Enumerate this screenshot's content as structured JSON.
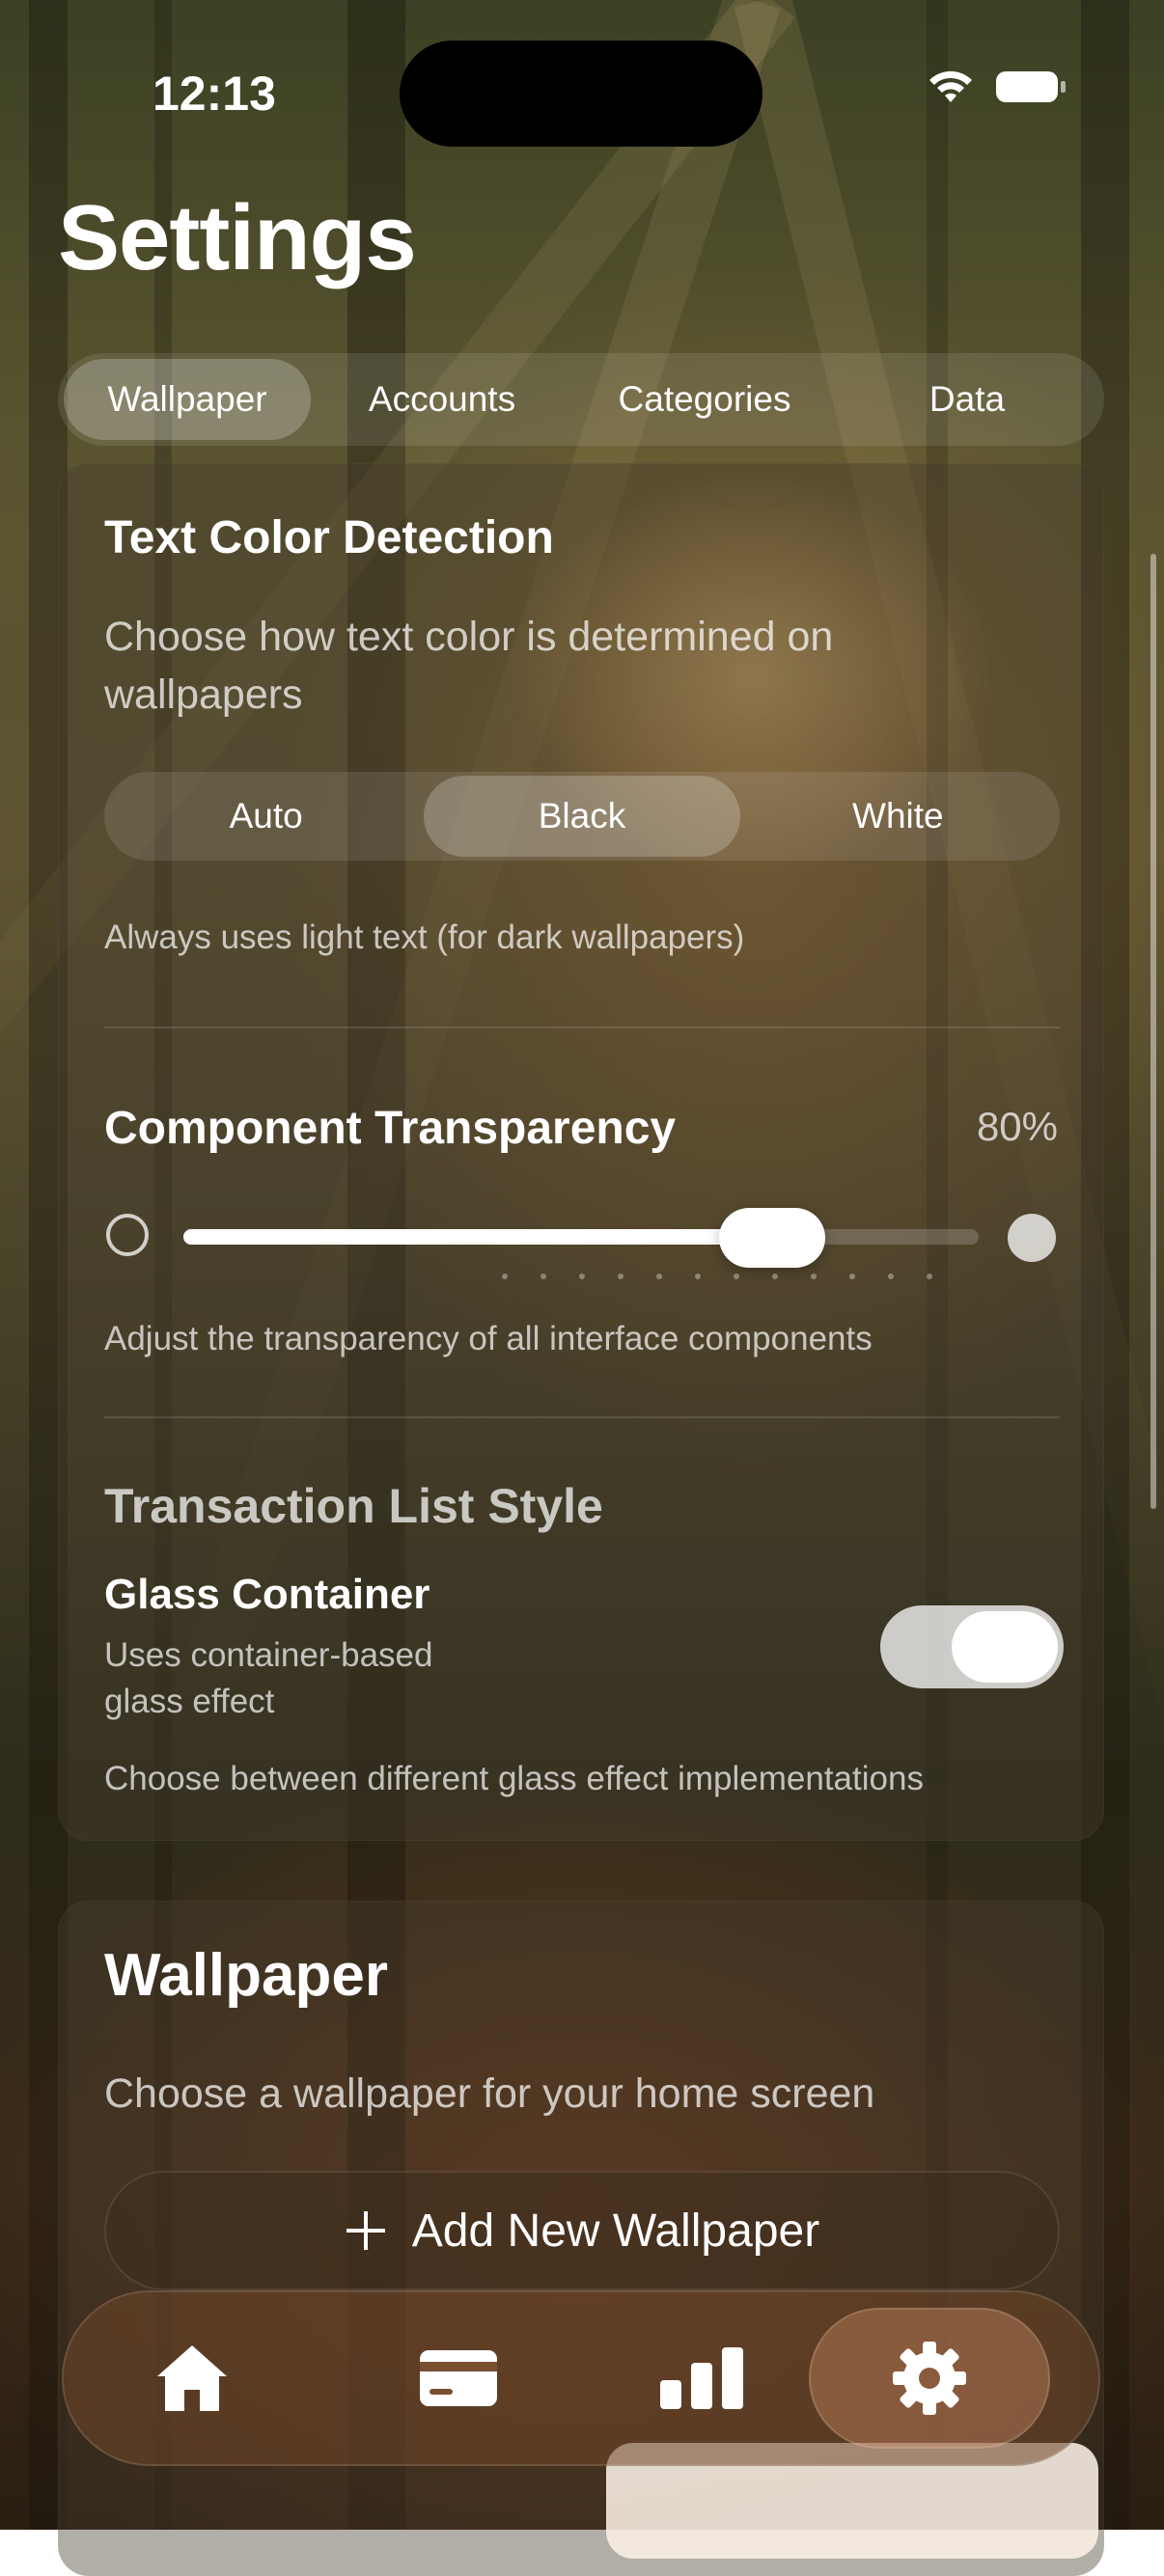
{
  "status_bar": {
    "time": "12:13"
  },
  "page": {
    "title": "Settings"
  },
  "top_tabs": [
    {
      "label": "Wallpaper",
      "active": true
    },
    {
      "label": "Accounts",
      "active": false
    },
    {
      "label": "Categories",
      "active": false
    },
    {
      "label": "Data",
      "active": false
    }
  ],
  "text_color": {
    "title": "Text Color Detection",
    "description": "Choose how text color is determined on wallpapers",
    "options": [
      "Auto",
      "Black",
      "White"
    ],
    "selected": "Black",
    "hint": "Always uses light text (for dark wallpapers)"
  },
  "transparency": {
    "title": "Component Transparency",
    "value_label": "80%",
    "value": 0.8,
    "hint": "Adjust the transparency of all interface components"
  },
  "transaction_style": {
    "title": "Transaction List Style",
    "option_title": "Glass Container",
    "option_desc": "Uses container-based glass effect",
    "toggle_on": true,
    "hint": "Choose between different glass effect implementations"
  },
  "wallpaper_section": {
    "title": "Wallpaper",
    "description": "Choose a wallpaper for your home screen",
    "add_label": "Add New Wallpaper"
  },
  "tab_bar": {
    "items": [
      {
        "icon": "house-icon"
      },
      {
        "icon": "card-icon"
      },
      {
        "icon": "chart-icon"
      },
      {
        "icon": "gear-icon",
        "active": true
      }
    ]
  },
  "colors": {
    "accent": "#ffffff",
    "tabbar_bg": "#6e4628",
    "card_bg": "#463c2d"
  }
}
